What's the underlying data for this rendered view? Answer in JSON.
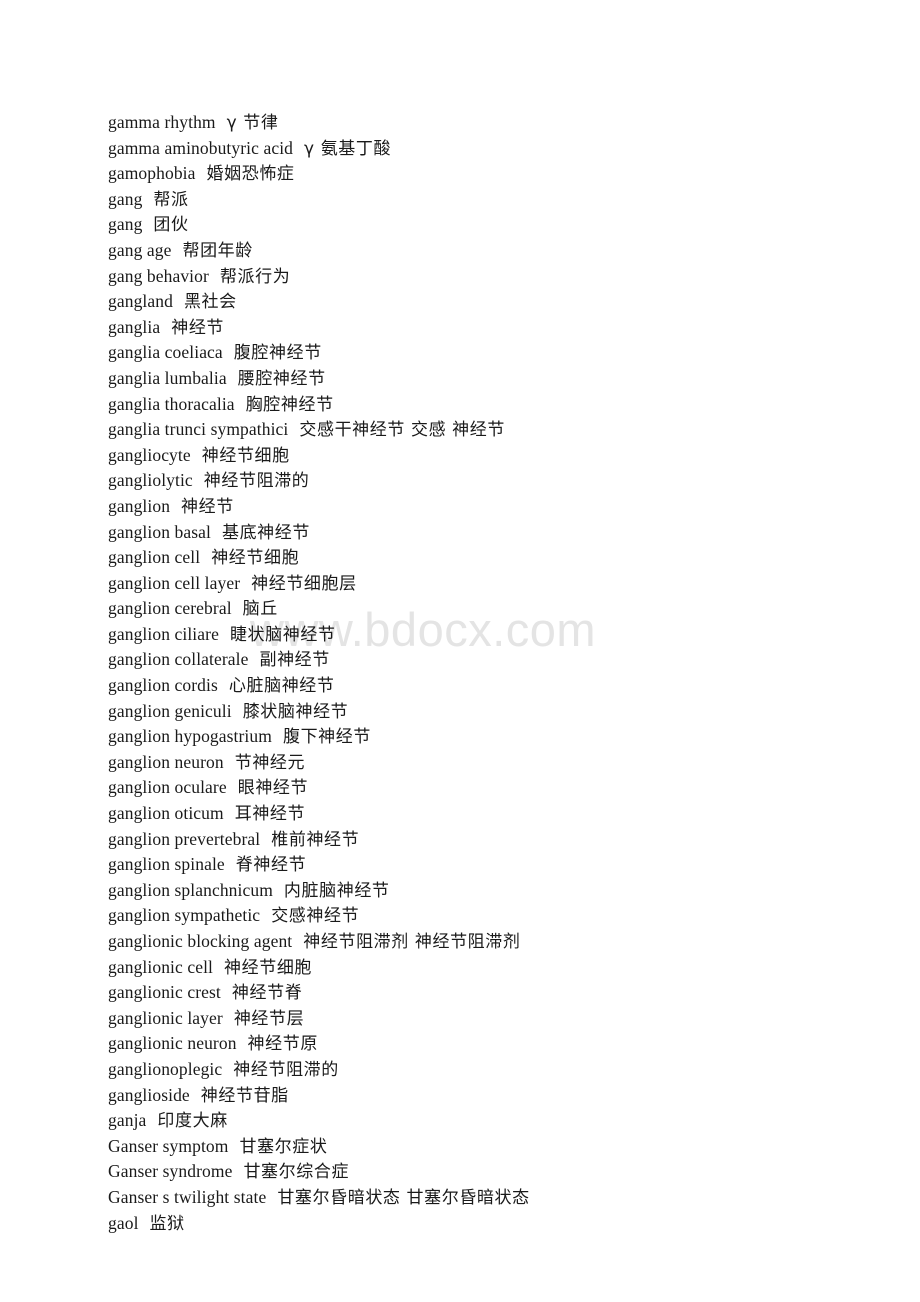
{
  "document": {
    "type": "glossary-page",
    "language_pair": "English-Chinese",
    "background_color": "#ffffff",
    "text_color": "#1a1a1a"
  },
  "watermark": {
    "text": "www.bdocx.com",
    "color": "#e4e4e4"
  },
  "glossary": {
    "entries": [
      {
        "term": "gamma  rhythm",
        "gloss": "γ 节律"
      },
      {
        "term": "gamma aminobutyric acid",
        "gloss": "γ 氨基丁酸"
      },
      {
        "term": "gamophobia",
        "gloss": "婚姻恐怖症"
      },
      {
        "term": "gang",
        "gloss": "帮派"
      },
      {
        "term": "gang",
        "gloss": "团伙"
      },
      {
        "term": "gang age",
        "gloss": "帮团年龄"
      },
      {
        "term": "gang behavior",
        "gloss": "帮派行为"
      },
      {
        "term": "gangland",
        "gloss": "黑社会"
      },
      {
        "term": "ganglia",
        "gloss": "神经节"
      },
      {
        "term": "ganglia coeliaca",
        "gloss": "腹腔神经节"
      },
      {
        "term": "ganglia lumbalia",
        "gloss": "腰腔神经节"
      },
      {
        "term": "ganglia thoracalia",
        "gloss": "胸腔神经节"
      },
      {
        "term": "ganglia trunci sympathici",
        "gloss": "交感干神经节 交感 神经节"
      },
      {
        "term": "gangliocyte",
        "gloss": "神经节细胞"
      },
      {
        "term": "gangliolytic",
        "gloss": "神经节阻滞的"
      },
      {
        "term": "ganglion",
        "gloss": "神经节"
      },
      {
        "term": "ganglion basal",
        "gloss": "基底神经节"
      },
      {
        "term": "ganglion cell",
        "gloss": "神经节细胞"
      },
      {
        "term": "ganglion cell layer",
        "gloss": "神经节细胞层"
      },
      {
        "term": "ganglion cerebral",
        "gloss": "脑丘"
      },
      {
        "term": "ganglion ciliare",
        "gloss": "睫状脑神经节"
      },
      {
        "term": "ganglion collaterale",
        "gloss": "副神经节"
      },
      {
        "term": "ganglion cordis",
        "gloss": "心脏脑神经节"
      },
      {
        "term": "ganglion geniculi",
        "gloss": "膝状脑神经节"
      },
      {
        "term": "ganglion hypogastrium",
        "gloss": "腹下神经节"
      },
      {
        "term": "ganglion neuron",
        "gloss": "节神经元"
      },
      {
        "term": "ganglion oculare",
        "gloss": "眼神经节"
      },
      {
        "term": "ganglion oticum",
        "gloss": "耳神经节"
      },
      {
        "term": "ganglion prevertebral",
        "gloss": "椎前神经节"
      },
      {
        "term": "ganglion spinale",
        "gloss": "脊神经节"
      },
      {
        "term": "ganglion splanchnicum",
        "gloss": "内脏脑神经节"
      },
      {
        "term": "ganglion sympathetic",
        "gloss": "交感神经节"
      },
      {
        "term": "ganglionic blocking agent",
        "gloss": "神经节阻滞剂 神经节阻滞剂"
      },
      {
        "term": "ganglionic cell",
        "gloss": "神经节细胞"
      },
      {
        "term": "ganglionic crest",
        "gloss": "神经节脊"
      },
      {
        "term": "ganglionic layer",
        "gloss": "神经节层"
      },
      {
        "term": "ganglionic neuron",
        "gloss": "神经节原"
      },
      {
        "term": "ganglionoplegic",
        "gloss": "神经节阻滞的"
      },
      {
        "term": "ganglioside",
        "gloss": "神经节苷脂"
      },
      {
        "term": "ganja",
        "gloss": "印度大麻"
      },
      {
        "term": "Ganser symptom",
        "gloss": "甘塞尔症状"
      },
      {
        "term": "Ganser syndrome",
        "gloss": "甘塞尔综合症"
      },
      {
        "term": "Ganser s twilight state",
        "gloss": "甘塞尔昏暗状态 甘塞尔昏暗状态"
      },
      {
        "term": "gaol",
        "gloss": "监狱"
      }
    ]
  }
}
